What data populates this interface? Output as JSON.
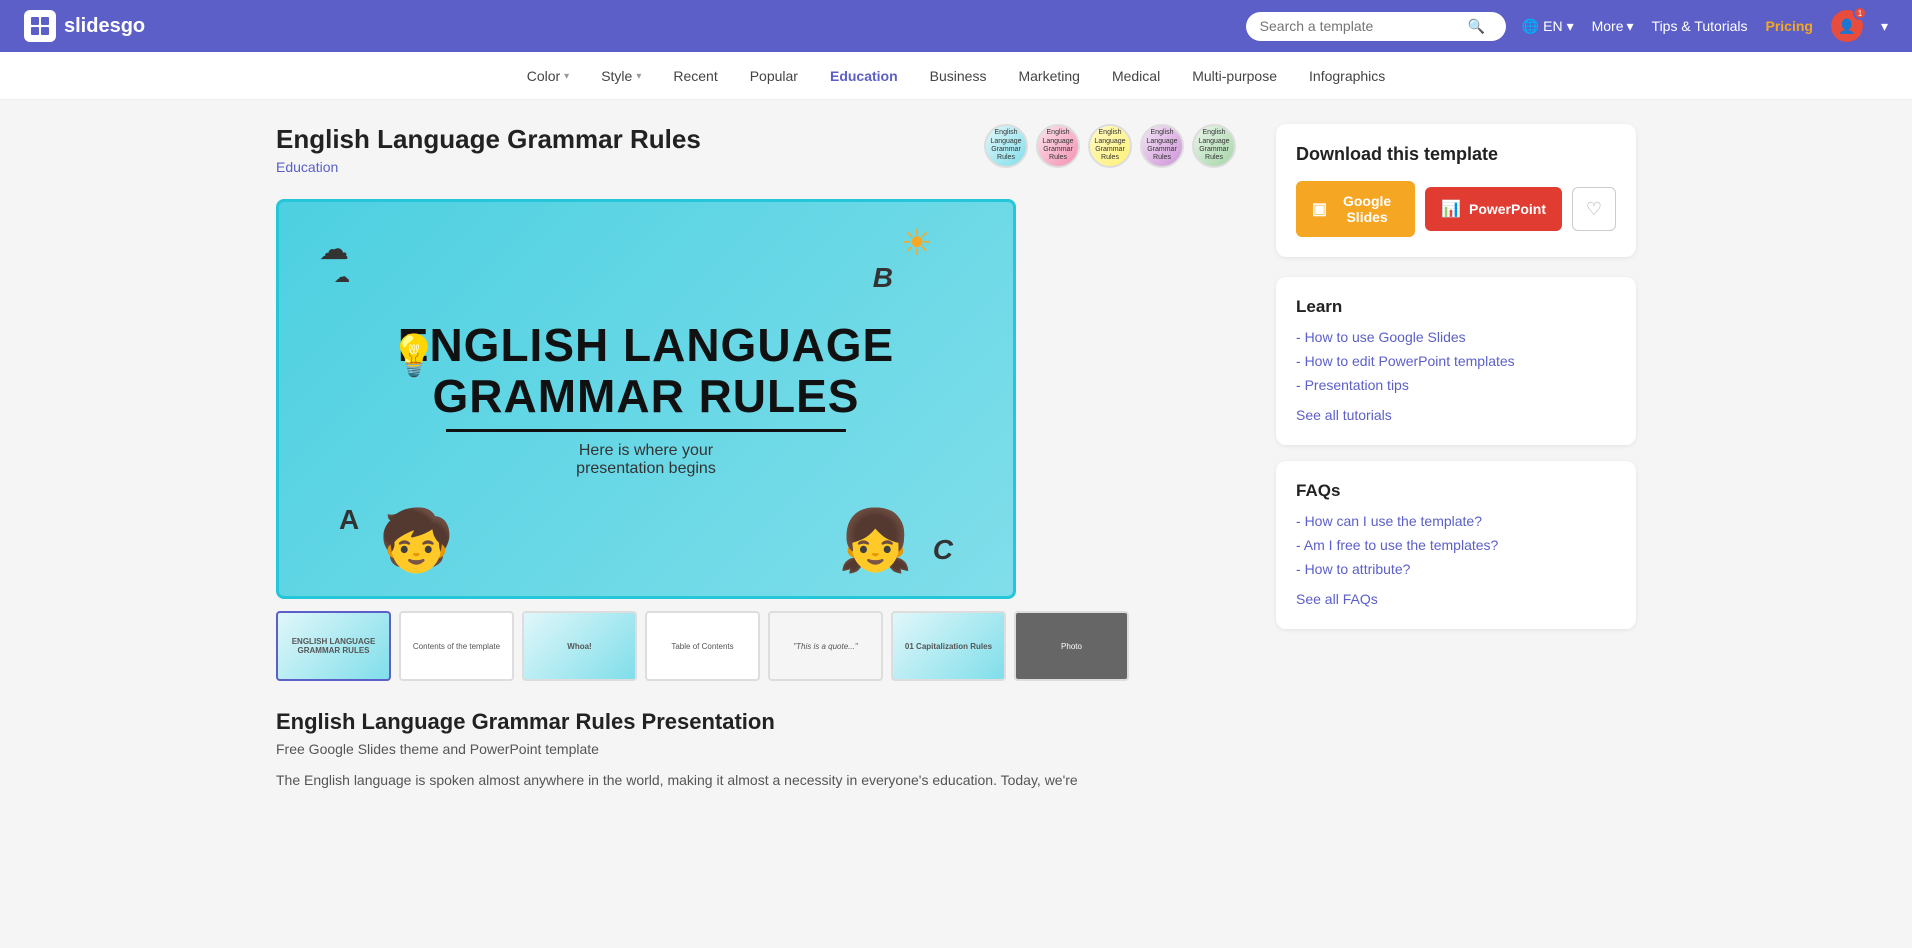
{
  "nav": {
    "logo_text": "slidesgo",
    "search_placeholder": "Search a template",
    "lang": "EN",
    "more": "More",
    "tips": "Tips & Tutorials",
    "pricing": "Pricing",
    "notif_count": "1"
  },
  "categories": [
    {
      "label": "Color",
      "dropdown": true
    },
    {
      "label": "Style",
      "dropdown": true
    },
    {
      "label": "Recent",
      "dropdown": false
    },
    {
      "label": "Popular",
      "dropdown": false
    },
    {
      "label": "Education",
      "dropdown": false,
      "active": true
    },
    {
      "label": "Business",
      "dropdown": false
    },
    {
      "label": "Marketing",
      "dropdown": false
    },
    {
      "label": "Medical",
      "dropdown": false
    },
    {
      "label": "Multi-purpose",
      "dropdown": false
    },
    {
      "label": "Infographics",
      "dropdown": false
    }
  ],
  "template": {
    "title": "English Language Grammar Rules",
    "category": "Education",
    "preview_title_line1": "English Language",
    "preview_title_line2": "Grammar Rules",
    "preview_subtitle": "Here is where your\npresentation begins",
    "variants": [
      {
        "bg": "#e0f7fa"
      },
      {
        "bg": "#fce4ec"
      },
      {
        "bg": "#fff9c4"
      },
      {
        "bg": "#f3e5f5"
      },
      {
        "bg": "#e8f5e9"
      }
    ],
    "thumbnails": [
      "English Language Grammar Rules",
      "Contents of the template",
      "Whoa!",
      "Table of Contents",
      "Quote slide",
      "01 Capitalization Rules",
      "Photo slide"
    ]
  },
  "download": {
    "title": "Download this template",
    "google_slides": "Google Slides",
    "powerpoint": "PowerPoint"
  },
  "learn": {
    "title": "Learn",
    "links": [
      "How to use Google Slides",
      "How to edit PowerPoint templates",
      "Presentation tips"
    ],
    "see_all": "See all tutorials"
  },
  "faqs": {
    "title": "FAQs",
    "links": [
      "How can I use the template?",
      "Am I free to use the templates?",
      "How to attribute?"
    ],
    "see_all": "See all FAQs"
  },
  "description": {
    "title": "English Language Grammar Rules Presentation",
    "subtitle": "Free Google Slides theme and PowerPoint template",
    "text": "The English language is spoken almost anywhere in the world, making it almost a necessity in everyone's education. Today, we're"
  }
}
